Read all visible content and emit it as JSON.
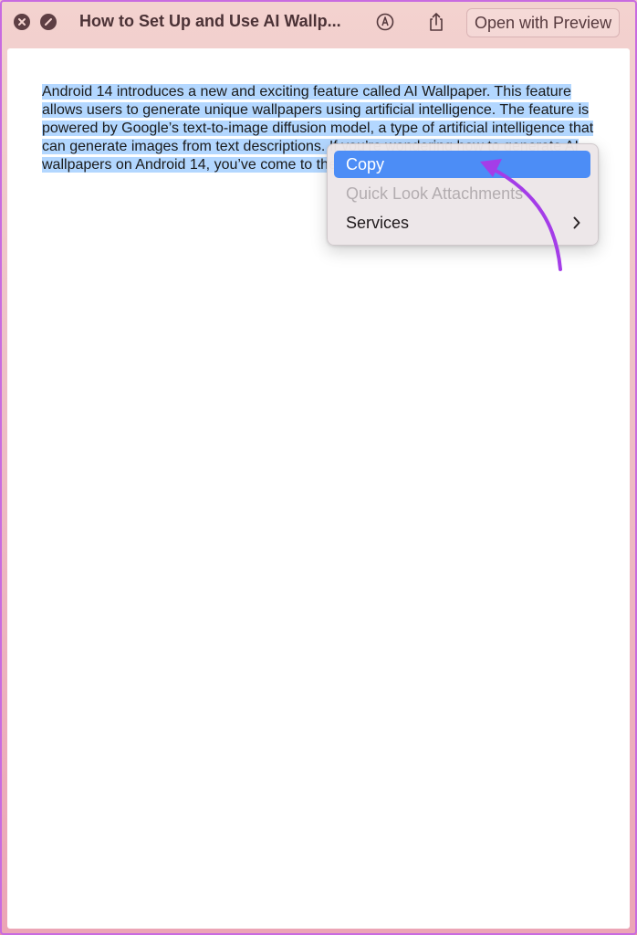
{
  "window": {
    "title": "How to Set Up and Use AI Wallp...",
    "open_button_label": "Open with Preview",
    "icons": [
      "close-icon",
      "hide-icon",
      "markup-icon",
      "share-icon"
    ]
  },
  "document": {
    "selected_text": "Android 14 introduces a new and exciting feature called AI Wallpaper. This feature allows users to generate unique wallpapers using artificial intelligence. The feature is powered by Google’s text-to-image diffusion model, a type of artificial intelligence that can generate images from text descriptions. If you’re wondering how to generate AI wallpapers on Android 14, you’ve come to the right place."
  },
  "context_menu": {
    "items": [
      {
        "label": "Copy",
        "state": "highlighted"
      },
      {
        "label": "Quick Look Attachments",
        "state": "disabled"
      },
      {
        "label": "Services",
        "state": "submenu"
      }
    ]
  },
  "colors": {
    "selection": "#b3d7ff",
    "menu_highlight": "#4c8df6",
    "annotation_arrow": "#a43de8"
  }
}
